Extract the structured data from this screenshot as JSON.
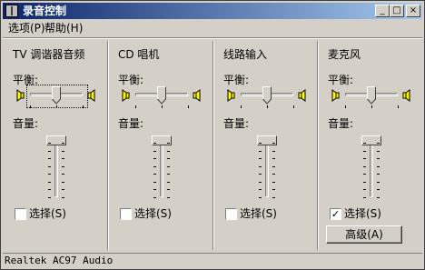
{
  "window": {
    "title": "录音控制"
  },
  "title_buttons": {
    "minimize": "_",
    "maximize": "□",
    "close": "×"
  },
  "menu": [
    {
      "label": "选项(P)"
    },
    {
      "label": "帮助(H)"
    }
  ],
  "balance_label": "平衡:",
  "volume_label": "音量:",
  "select_label": "选择(S)",
  "channels": [
    {
      "name": "TV 调谐器音频",
      "selected": false,
      "balance": 0.5,
      "volume": 1.0
    },
    {
      "name": "CD 唱机",
      "selected": false,
      "balance": 0.5,
      "volume": 1.0
    },
    {
      "name": "线路输入",
      "selected": false,
      "balance": 0.5,
      "volume": 1.0
    },
    {
      "name": "麦克风",
      "selected": true,
      "balance": 0.5,
      "volume": 1.0
    }
  ],
  "advanced_button": "高级(A)",
  "status_text": "Realtek AC97 Audio",
  "colors": {
    "title_left": "#0a246a",
    "title_right": "#a6caf0",
    "face": "#d4d0c8"
  }
}
